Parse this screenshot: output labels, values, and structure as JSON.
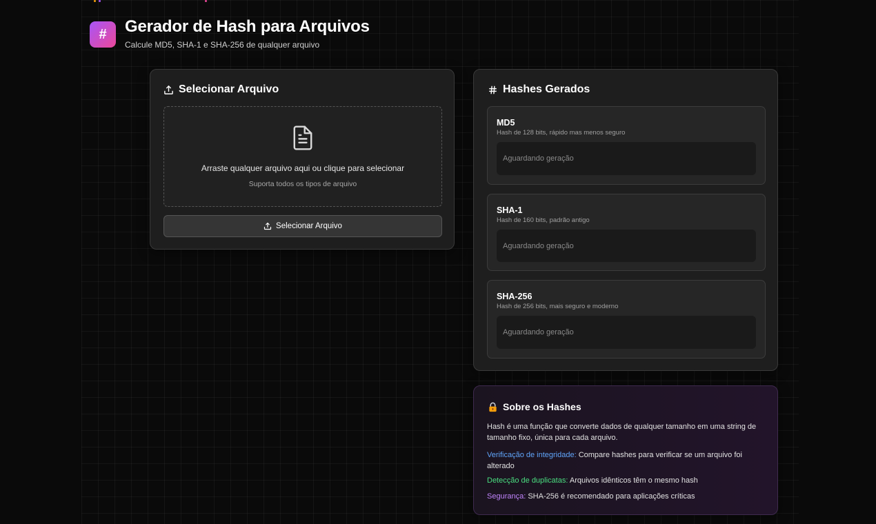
{
  "header": {
    "logo_glyph": "#",
    "title": "Gerador de Hash para Arquivos",
    "subtitle": "Calcule MD5, SHA-1 e SHA-256 de qualquer arquivo"
  },
  "upload": {
    "title": "Selecionar Arquivo",
    "drop_main": "Arraste qualquer arquivo aqui ou clique para selecionar",
    "drop_sub": "Suporta todos os tipos de arquivo",
    "button_label": "Selecionar Arquivo"
  },
  "hashes": {
    "title": "Hashes Gerados",
    "items": [
      {
        "name": "MD5",
        "description": "Hash de 128 bits, rápido mas menos seguro",
        "value": "Aguardando geração"
      },
      {
        "name": "SHA-1",
        "description": "Hash de 160 bits, padrão antigo",
        "value": "Aguardando geração"
      },
      {
        "name": "SHA-256",
        "description": "Hash de 256 bits, mais seguro e moderno",
        "value": "Aguardando geração"
      }
    ]
  },
  "about": {
    "icon": "lock-icon",
    "title": "Sobre os Hashes",
    "intro": "Hash é uma função que converte dados de qualquer tamanho em uma string de tamanho fixo, única para cada arquivo.",
    "points": [
      {
        "key": "Verificação de integridade:",
        "text": " Compare hashes para verificar se um arquivo foi alterado"
      },
      {
        "key": "Detecção de duplicatas:",
        "text": " Arquivos idênticos têm o mesmo hash"
      },
      {
        "key": "Segurança:",
        "text": " SHA-256 é recomendado para aplicações críticas"
      }
    ]
  },
  "colors": {
    "accent_gradient_start": "#a855f7",
    "accent_gradient_end": "#ec4899",
    "integrity": "#60a5fa",
    "duplicates": "#4ade80",
    "security": "#c084fc"
  }
}
